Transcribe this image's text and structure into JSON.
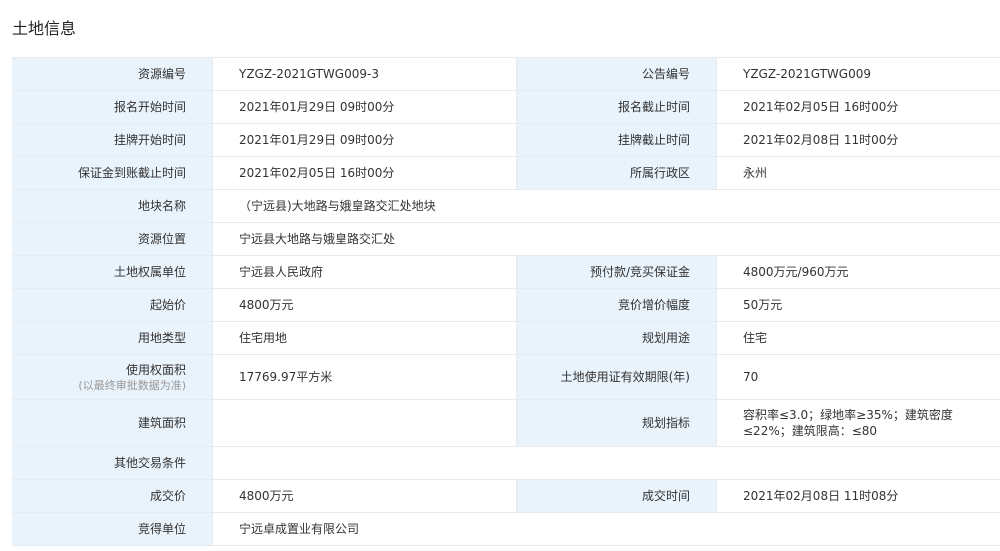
{
  "title": "土地信息",
  "rows": [
    {
      "l1": "资源编号",
      "v1": "YZGZ-2021GTWG009-3",
      "l2": "公告编号",
      "v2": "YZGZ-2021GTWG009"
    },
    {
      "l1": "报名开始时间",
      "v1": "2021年01月29日 09时00分",
      "l2": "报名截止时间",
      "v2": "2021年02月05日 16时00分"
    },
    {
      "l1": "挂牌开始时间",
      "v1": "2021年01月29日 09时00分",
      "l2": "挂牌截止时间",
      "v2": "2021年02月08日 11时00分"
    },
    {
      "l1": "保证金到账截止时间",
      "v1": "2021年02月05日 16时00分",
      "l2": "所属行政区",
      "v2": "永州"
    },
    {
      "l1": "地块名称",
      "v1": "（宁远县)大地路与娥皇路交汇处地块"
    },
    {
      "l1": "资源位置",
      "v1": "宁远县大地路与娥皇路交汇处"
    },
    {
      "l1": "土地权属单位",
      "v1": "宁远县人民政府",
      "l2": "预付款/竞买保证金",
      "v2": "4800万元/960万元"
    },
    {
      "l1": "起始价",
      "v1": "4800万元",
      "l2": "竞价增价幅度",
      "v2": "50万元"
    },
    {
      "l1": "用地类型",
      "v1": "住宅用地",
      "l2": "规划用途",
      "v2": "住宅"
    },
    {
      "l1": "使用权面积",
      "l1_sub": "(以最终审批数据为准)",
      "v1": "17769.97平方米",
      "l2": "土地使用证有效期限(年)",
      "v2": "70"
    },
    {
      "l1": "建筑面积",
      "v1": "",
      "l2": "规划指标",
      "v2": "容积率≤3.0；绿地率≥35%；建筑密度≤22%；建筑限高：≤80"
    },
    {
      "l1": "其他交易条件",
      "v1": ""
    },
    {
      "l1": "成交价",
      "v1": "4800万元",
      "l2": "成交时间",
      "v2": "2021年02月08日 11时08分"
    },
    {
      "l1": "竞得单位",
      "v1": "宁远卓成置业有限公司"
    }
  ]
}
